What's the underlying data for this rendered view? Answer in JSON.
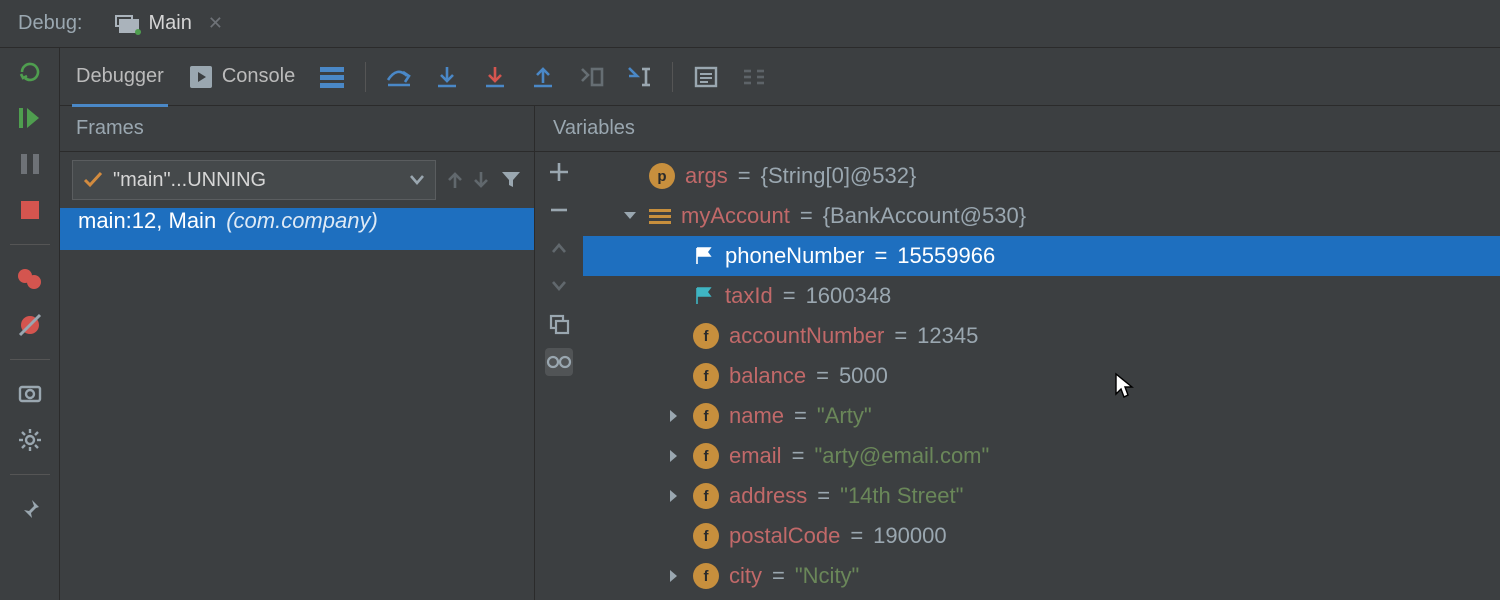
{
  "header": {
    "debugLabel": "Debug:",
    "tabTitle": "Main"
  },
  "toolbar": {
    "debugger": "Debugger",
    "console": "Console"
  },
  "panels": {
    "framesTitle": "Frames",
    "variablesTitle": "Variables"
  },
  "frames": {
    "threadLabel": "\"main\"...UNNING",
    "stack": [
      {
        "loc": "main:12, Main",
        "pkg": "(com.company)"
      }
    ]
  },
  "variables": [
    {
      "indent": 0,
      "expand": "",
      "icon": "p",
      "name": "args",
      "value": "{String[0]@532}",
      "cls": ""
    },
    {
      "indent": 0,
      "expand": "down",
      "icon": "lines",
      "name": "myAccount",
      "value": "{BankAccount@530}",
      "cls": ""
    },
    {
      "indent": 1,
      "expand": "",
      "icon": "flag",
      "name": "phoneNumber",
      "value": "15559966",
      "cls": "",
      "selected": true
    },
    {
      "indent": 1,
      "expand": "",
      "icon": "flag",
      "name": "taxId",
      "value": "1600348",
      "cls": ""
    },
    {
      "indent": 1,
      "expand": "",
      "icon": "f",
      "name": "accountNumber",
      "value": "12345",
      "cls": ""
    },
    {
      "indent": 1,
      "expand": "",
      "icon": "f",
      "name": "balance",
      "value": "5000",
      "cls": ""
    },
    {
      "indent": 1,
      "expand": "right",
      "icon": "f",
      "name": "name",
      "value": "\"Arty\"",
      "cls": "str"
    },
    {
      "indent": 1,
      "expand": "right",
      "icon": "f",
      "name": "email",
      "value": "\"arty@email.com\"",
      "cls": "str"
    },
    {
      "indent": 1,
      "expand": "right",
      "icon": "f",
      "name": "address",
      "value": "\"14th Street\"",
      "cls": "str"
    },
    {
      "indent": 1,
      "expand": "",
      "icon": "f",
      "name": "postalCode",
      "value": "190000",
      "cls": ""
    },
    {
      "indent": 1,
      "expand": "right",
      "icon": "f",
      "name": "city",
      "value": "\"Ncity\"",
      "cls": "str"
    }
  ]
}
